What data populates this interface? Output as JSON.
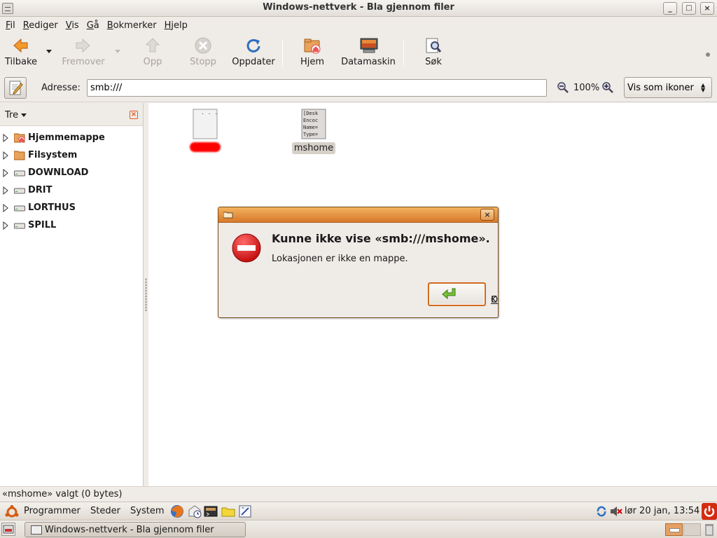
{
  "window": {
    "title": "Windows-nettverk - Bla gjennom filer",
    "minimize": "_",
    "maximize": "□",
    "close": "×"
  },
  "menu": [
    {
      "label": "Fil",
      "mnemonic": "F"
    },
    {
      "label": "Rediger",
      "mnemonic": "R"
    },
    {
      "label": "Vis",
      "mnemonic": "V"
    },
    {
      "label": "Gå",
      "mnemonic": "G"
    },
    {
      "label": "Bokmerker",
      "mnemonic": "B"
    },
    {
      "label": "Hjelp",
      "mnemonic": "H"
    }
  ],
  "toolbar": {
    "back": "Tilbake",
    "forward": "Fremover",
    "up": "Opp",
    "stop": "Stopp",
    "reload": "Oppdater",
    "home": "Hjem",
    "computer": "Datamaskin",
    "search": "Søk"
  },
  "location": {
    "label": "Adresse:",
    "value": "smb:///",
    "zoom": "100%",
    "view_mode": "Vis som ikoner"
  },
  "sidebar": {
    "mode": "Tre",
    "items": [
      {
        "label": "Hjemmemappe",
        "icon": "home-folder-icon"
      },
      {
        "label": "Filsystem",
        "icon": "folder-icon"
      },
      {
        "label": "DOWNLOAD",
        "icon": "drive-icon"
      },
      {
        "label": "DRIT",
        "icon": "drive-icon"
      },
      {
        "label": "LORTHUS",
        "icon": "drive-icon"
      },
      {
        "label": "SPILL",
        "icon": "drive-icon"
      }
    ]
  },
  "files": [
    {
      "label": "",
      "redacted": true,
      "icon": "blank-file-icon"
    },
    {
      "label": "mshome",
      "selected": true,
      "icon": "desktop-file-icon",
      "preview": [
        "[Desk",
        "Encoc",
        "Name=",
        "Type="
      ]
    }
  ],
  "dialog": {
    "heading": "Kunne ikke vise «smb:///mshome».",
    "message": "Lokasjonen er ikke en mappe.",
    "ok_label": "OK",
    "close": "×"
  },
  "status": {
    "text": "«mshome» valgt (0 bytes)"
  },
  "panel": {
    "applications": "Programmer",
    "places": "Steder",
    "system": "System",
    "clock": "lør 20 jan, 13:54",
    "task": "Windows-nettverk - Bla gjennom filer"
  },
  "colors": {
    "accent": "#d7782a",
    "error": "#d3141b",
    "ok_border": "#cf6a1e"
  }
}
